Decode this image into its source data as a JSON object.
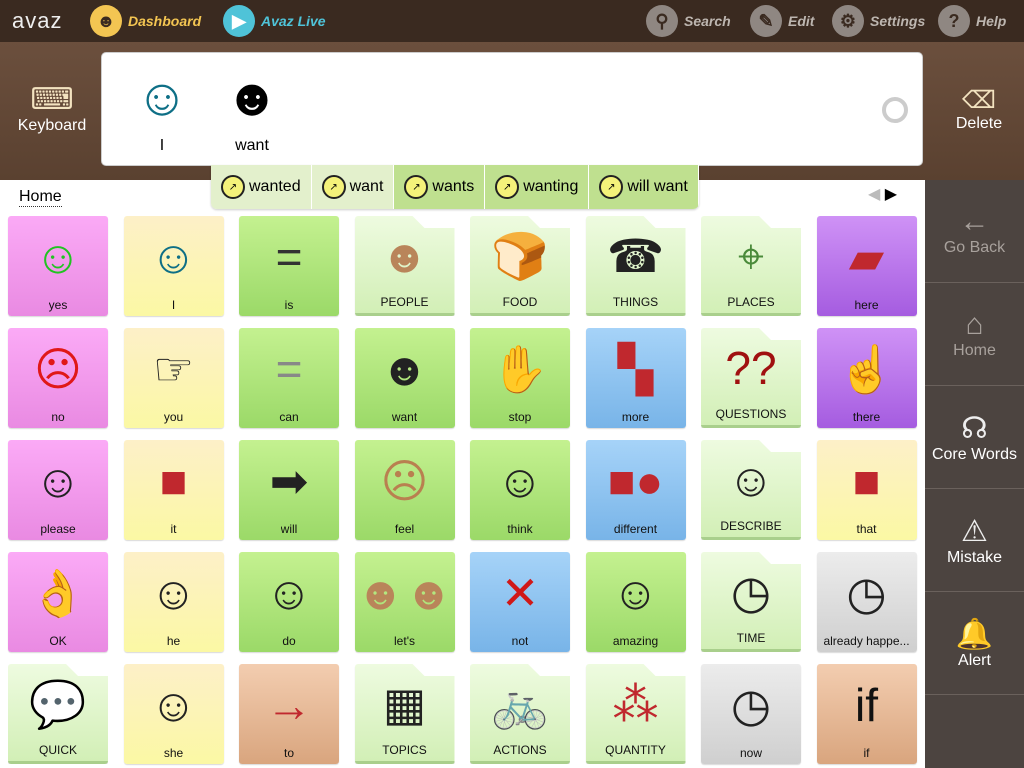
{
  "topbar": {
    "logo": "avaz",
    "dashboard": "Dashboard",
    "live": "Avaz Live",
    "search": "Search",
    "edit": "Edit",
    "settings": "Settings",
    "help": "Help"
  },
  "message_bar": {
    "keyboard": "Keyboard",
    "delete": "Delete",
    "words": [
      {
        "label": "I",
        "icon": "☺"
      },
      {
        "label": "want",
        "icon": "☻"
      }
    ]
  },
  "tenses": [
    {
      "label": "wanted",
      "active": false
    },
    {
      "label": "want",
      "active": false
    },
    {
      "label": "wants",
      "active": true
    },
    {
      "label": "wanting",
      "active": true
    },
    {
      "label": "will want",
      "active": true
    }
  ],
  "breadcrumb": "Home",
  "nav": [
    {
      "label": "Go Back",
      "icon": "←",
      "dim": true
    },
    {
      "label": "Home",
      "icon": "⌂",
      "dim": true
    },
    {
      "label": "Core Words",
      "icon": "☊",
      "dim": false
    },
    {
      "label": "Mistake",
      "icon": "⚠",
      "dim": false
    },
    {
      "label": "Alert",
      "icon": "🔔",
      "dim": false
    }
  ],
  "tiles": [
    [
      {
        "l": "yes",
        "c": "pink",
        "i": "☺",
        "ic": "#22c322"
      },
      {
        "l": "I",
        "c": "yellow",
        "i": "☺",
        "ic": "#0e6f86"
      },
      {
        "l": "is",
        "c": "green",
        "i": "=",
        "ic": "#333"
      },
      {
        "l": "PEOPLE",
        "c": "folder",
        "i": "☻",
        "ic": "#b9855a"
      },
      {
        "l": "FOOD",
        "c": "folder",
        "i": "🍞",
        "ic": "#c36"
      },
      {
        "l": "THINGS",
        "c": "folder",
        "i": "☎",
        "ic": "#222"
      },
      {
        "l": "PLACES",
        "c": "folder",
        "i": "⌖",
        "ic": "#4a8a3a"
      },
      {
        "l": "here",
        "c": "purple",
        "i": "▰",
        "ic": "#c0282e"
      }
    ],
    [
      {
        "l": "no",
        "c": "pink",
        "i": "☹",
        "ic": "#e01818"
      },
      {
        "l": "you",
        "c": "yellow",
        "i": "☞",
        "ic": "#222"
      },
      {
        "l": "can",
        "c": "green",
        "i": "=",
        "ic": "#888"
      },
      {
        "l": "want",
        "c": "green",
        "i": "☻",
        "ic": "#222"
      },
      {
        "l": "stop",
        "c": "green",
        "i": "✋",
        "ic": "#c0282e"
      },
      {
        "l": "more",
        "c": "blue",
        "i": "▚",
        "ic": "#c0282e"
      },
      {
        "l": "QUESTIONS",
        "c": "folder",
        "i": "??",
        "ic": "#a01010"
      },
      {
        "l": "there",
        "c": "purple",
        "i": "☝",
        "ic": "#222"
      }
    ],
    [
      {
        "l": "please",
        "c": "pink",
        "i": "☺",
        "ic": "#222"
      },
      {
        "l": "it",
        "c": "yellow",
        "i": "■",
        "ic": "#c0282e"
      },
      {
        "l": "will",
        "c": "green",
        "i": "➡",
        "ic": "#222"
      },
      {
        "l": "feel",
        "c": "green",
        "i": "☹",
        "ic": "#b98050"
      },
      {
        "l": "think",
        "c": "green",
        "i": "☺",
        "ic": "#222"
      },
      {
        "l": "different",
        "c": "blue",
        "i": "■●",
        "ic": "#c0282e"
      },
      {
        "l": "DESCRIBE",
        "c": "folder",
        "i": "☺",
        "ic": "#222"
      },
      {
        "l": "that",
        "c": "yellow",
        "i": "■",
        "ic": "#c0282e"
      }
    ],
    [
      {
        "l": "OK",
        "c": "pink",
        "i": "👌",
        "ic": "#111"
      },
      {
        "l": "he",
        "c": "yellow",
        "i": "☺",
        "ic": "#222"
      },
      {
        "l": "do",
        "c": "green",
        "i": "☺",
        "ic": "#222"
      },
      {
        "l": "let's",
        "c": "green",
        "i": "☻☻",
        "ic": "#b9855a"
      },
      {
        "l": "not",
        "c": "blue",
        "i": "✕",
        "ic": "#d01818"
      },
      {
        "l": "amazing",
        "c": "green",
        "i": "☺",
        "ic": "#222"
      },
      {
        "l": "TIME",
        "c": "folder",
        "i": "◷",
        "ic": "#222"
      },
      {
        "l": "already happe...",
        "c": "grey",
        "i": "◷",
        "ic": "#222"
      }
    ],
    [
      {
        "l": "QUICK",
        "c": "folder",
        "i": "💬",
        "ic": "#222"
      },
      {
        "l": "she",
        "c": "yellow",
        "i": "☺",
        "ic": "#222"
      },
      {
        "l": "to",
        "c": "tan",
        "i": "→",
        "ic": "#c0282e"
      },
      {
        "l": "TOPICS",
        "c": "folder",
        "i": "▦",
        "ic": "#222"
      },
      {
        "l": "ACTIONS",
        "c": "folder",
        "i": "🚲",
        "ic": "#222"
      },
      {
        "l": "QUANTITY",
        "c": "folder",
        "i": "⁂",
        "ic": "#c0282e"
      },
      {
        "l": "now",
        "c": "grey",
        "i": "◷",
        "ic": "#222"
      },
      {
        "l": "if",
        "c": "tan",
        "i": "if",
        "ic": "#111"
      }
    ]
  ]
}
